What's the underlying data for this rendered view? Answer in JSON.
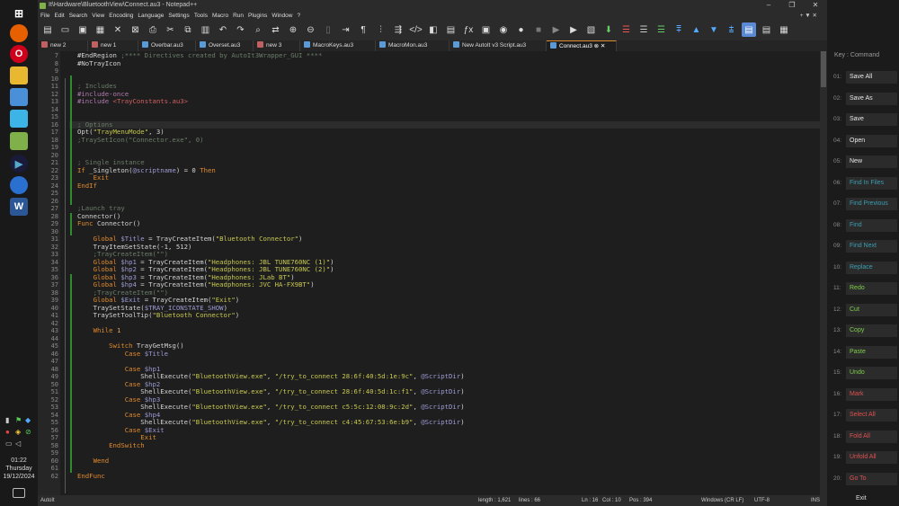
{
  "window": {
    "title": "It\\Hardware\\BluetoothView\\Connect.au3 - Notepad++",
    "minimize": "–",
    "restore": "❐",
    "close": "✕"
  },
  "menu": [
    "File",
    "Edit",
    "Search",
    "View",
    "Encoding",
    "Language",
    "Settings",
    "Tools",
    "Macro",
    "Run",
    "Plugins",
    "Window",
    "?"
  ],
  "menu_right": "+ ▼ ✕",
  "tabs": [
    {
      "label": "new 2",
      "color": "#c06060"
    },
    {
      "label": "new 1",
      "color": "#c06060"
    },
    {
      "label": "Overbar.au3",
      "color": "#5a9ad6"
    },
    {
      "label": "Overset.au3",
      "color": "#5a9ad6"
    },
    {
      "label": "new 3",
      "color": "#c06060"
    },
    {
      "label": "MacroKeys.au3",
      "color": "#5a9ad6"
    },
    {
      "label": "MacroMon.au3",
      "color": "#5a9ad6"
    },
    {
      "label": "New AutoIt v3 Script.au3",
      "color": "#5a9ad6"
    },
    {
      "label": "Connect.au3",
      "color": "#5a9ad6"
    }
  ],
  "lines": [
    {
      "n": "7",
      "t": [
        [
          "o",
          "#EndRegion "
        ],
        [
          "c",
          ";**** Directives created by AutoIt3Wrapper_GUI ****"
        ]
      ]
    },
    {
      "n": "8",
      "t": [
        [
          "o",
          "#NoTrayIcon"
        ]
      ]
    },
    {
      "n": "9",
      "t": []
    },
    {
      "n": "10",
      "t": []
    },
    {
      "n": "11",
      "t": [
        [
          "c",
          "; Includes"
        ]
      ]
    },
    {
      "n": "12",
      "t": [
        [
          "m",
          "#include-once"
        ]
      ]
    },
    {
      "n": "13",
      "t": [
        [
          "m",
          "#include "
        ],
        [
          "i",
          "<TrayConstants.au3>"
        ]
      ]
    },
    {
      "n": "14",
      "t": []
    },
    {
      "n": "15",
      "t": []
    },
    {
      "n": "16",
      "t": [
        [
          "c",
          "; Options"
        ]
      ]
    },
    {
      "n": "17",
      "t": [
        [
          "f",
          "Opt("
        ],
        [
          "s",
          "\"TrayMenuMode\""
        ],
        [
          "o",
          ", 3)"
        ]
      ]
    },
    {
      "n": "18",
      "t": [
        [
          "c",
          ";TraySetIcon(\"Connector.exe\", 0)"
        ]
      ]
    },
    {
      "n": "19",
      "t": []
    },
    {
      "n": "20",
      "t": []
    },
    {
      "n": "21",
      "t": [
        [
          "c",
          "; Single instance"
        ]
      ]
    },
    {
      "n": "22",
      "t": [
        [
          "k",
          "If "
        ],
        [
          "o",
          "_Singleton("
        ],
        [
          "v",
          "@scriptname"
        ],
        [
          "o",
          ") = 0 "
        ],
        [
          "k",
          "Then"
        ]
      ]
    },
    {
      "n": "23",
      "t": [
        [
          "k",
          "    Exit"
        ]
      ]
    },
    {
      "n": "24",
      "t": [
        [
          "k",
          "EndIf"
        ]
      ]
    },
    {
      "n": "25",
      "t": []
    },
    {
      "n": "26",
      "t": []
    },
    {
      "n": "27",
      "t": [
        [
          "c",
          ";Launch tray"
        ]
      ]
    },
    {
      "n": "28",
      "t": [
        [
          "o",
          "Connector()"
        ]
      ]
    },
    {
      "n": "29",
      "t": [
        [
          "k",
          "Func "
        ],
        [
          "o",
          "Connector()"
        ]
      ]
    },
    {
      "n": "30",
      "t": []
    },
    {
      "n": "31",
      "t": [
        [
          "k",
          "    Global "
        ],
        [
          "v",
          "$Title"
        ],
        [
          "o",
          " = TrayCreateItem("
        ],
        [
          "s",
          "\"Bluetooth Connector\""
        ],
        [
          "o",
          ")"
        ]
      ]
    },
    {
      "n": "32",
      "t": [
        [
          "o",
          "    TrayItemSetState(-1, 512)"
        ]
      ]
    },
    {
      "n": "33",
      "t": [
        [
          "c",
          "    ;TrayCreateItem(\"\")"
        ]
      ]
    },
    {
      "n": "34",
      "t": [
        [
          "k",
          "    Global "
        ],
        [
          "v",
          "$hp1"
        ],
        [
          "o",
          " = TrayCreateItem("
        ],
        [
          "s",
          "\"Headphones: JBL TUNE760NC (1)\""
        ],
        [
          "o",
          ")"
        ]
      ]
    },
    {
      "n": "35",
      "t": [
        [
          "k",
          "    Global "
        ],
        [
          "v",
          "$hp2"
        ],
        [
          "o",
          " = TrayCreateItem("
        ],
        [
          "s",
          "\"Headphones: JBL TUNE760NC (2)\""
        ],
        [
          "o",
          ")"
        ]
      ]
    },
    {
      "n": "36",
      "t": [
        [
          "k",
          "    Global "
        ],
        [
          "v",
          "$hp3"
        ],
        [
          "o",
          " = TrayCreateItem("
        ],
        [
          "s",
          "\"Headphones: JLab BT\""
        ],
        [
          "o",
          ")"
        ]
      ]
    },
    {
      "n": "37",
      "t": [
        [
          "k",
          "    Global "
        ],
        [
          "v",
          "$hp4"
        ],
        [
          "o",
          " = TrayCreateItem("
        ],
        [
          "s",
          "\"Headphones: JVC HA-FX9BT\""
        ],
        [
          "o",
          ")"
        ]
      ]
    },
    {
      "n": "38",
      "t": [
        [
          "c",
          "    ;TrayCreateItem(\"\")"
        ]
      ]
    },
    {
      "n": "39",
      "t": [
        [
          "k",
          "    Global "
        ],
        [
          "v",
          "$Exit"
        ],
        [
          "o",
          " = TrayCreateItem("
        ],
        [
          "s",
          "\"Exit\""
        ],
        [
          "o",
          ")"
        ]
      ]
    },
    {
      "n": "40",
      "t": [
        [
          "o",
          "    TraySetState("
        ],
        [
          "v",
          "$TRAY_ICONSTATE_SHOW"
        ],
        [
          "o",
          ")"
        ]
      ]
    },
    {
      "n": "41",
      "t": [
        [
          "o",
          "    TraySetToolTip("
        ],
        [
          "s",
          "\"Bluetooth Connector\""
        ],
        [
          "o",
          ")"
        ]
      ]
    },
    {
      "n": "42",
      "t": []
    },
    {
      "n": "43",
      "t": [
        [
          "k",
          "    While "
        ],
        [
          "n",
          "1"
        ]
      ]
    },
    {
      "n": "44",
      "t": []
    },
    {
      "n": "45",
      "t": [
        [
          "k",
          "        Switch "
        ],
        [
          "o",
          "TrayGetMsg()"
        ]
      ]
    },
    {
      "n": "46",
      "t": [
        [
          "k",
          "            Case "
        ],
        [
          "v",
          "$Title"
        ]
      ]
    },
    {
      "n": "47",
      "t": []
    },
    {
      "n": "48",
      "t": [
        [
          "k",
          "            Case "
        ],
        [
          "v",
          "$hp1"
        ]
      ]
    },
    {
      "n": "49",
      "t": [
        [
          "o",
          "                ShellExecute("
        ],
        [
          "s",
          "\"BluetoothView.exe\""
        ],
        [
          "o",
          ", "
        ],
        [
          "s",
          "\"/try_to_connect 28:6f:40:5d:1e:9c\""
        ],
        [
          "o",
          ", "
        ],
        [
          "v",
          "@ScriptDir"
        ],
        [
          "o",
          ")"
        ]
      ]
    },
    {
      "n": "50",
      "t": [
        [
          "k",
          "            Case "
        ],
        [
          "v",
          "$hp2"
        ]
      ]
    },
    {
      "n": "51",
      "t": [
        [
          "o",
          "                ShellExecute("
        ],
        [
          "s",
          "\"BluetoothView.exe\""
        ],
        [
          "o",
          ", "
        ],
        [
          "s",
          "\"/try_to_connect 28:6f:40:5d:1c:f1\""
        ],
        [
          "o",
          ", "
        ],
        [
          "v",
          "@ScriptDir"
        ],
        [
          "o",
          ")"
        ]
      ]
    },
    {
      "n": "52",
      "t": [
        [
          "k",
          "            Case "
        ],
        [
          "v",
          "$hp3"
        ]
      ]
    },
    {
      "n": "53",
      "t": [
        [
          "o",
          "                ShellExecute("
        ],
        [
          "s",
          "\"BluetoothView.exe\""
        ],
        [
          "o",
          ", "
        ],
        [
          "s",
          "\"/try_to_connect c5:5c:12:08:9c:2d\""
        ],
        [
          "o",
          ", "
        ],
        [
          "v",
          "@ScriptDir"
        ],
        [
          "o",
          ")"
        ]
      ]
    },
    {
      "n": "54",
      "t": [
        [
          "k",
          "            Case "
        ],
        [
          "v",
          "$hp4"
        ]
      ]
    },
    {
      "n": "55",
      "t": [
        [
          "o",
          "                ShellExecute("
        ],
        [
          "s",
          "\"BluetoothView.exe\""
        ],
        [
          "o",
          ", "
        ],
        [
          "s",
          "\"/try_to_connect c4:45:67:53:6e:b9\""
        ],
        [
          "o",
          ", "
        ],
        [
          "v",
          "@ScriptDir"
        ],
        [
          "o",
          ")"
        ]
      ]
    },
    {
      "n": "56",
      "t": [
        [
          "k",
          "            Case "
        ],
        [
          "v",
          "$Exit"
        ]
      ]
    },
    {
      "n": "57",
      "t": [
        [
          "k",
          "                Exit"
        ]
      ]
    },
    {
      "n": "58",
      "t": [
        [
          "k",
          "        EndSwitch"
        ]
      ]
    },
    {
      "n": "59",
      "t": []
    },
    {
      "n": "60",
      "t": [
        [
          "k",
          "    Wend"
        ]
      ]
    },
    {
      "n": "61",
      "t": []
    },
    {
      "n": "62",
      "t": [
        [
          "k",
          "EndFunc"
        ]
      ]
    }
  ],
  "status": {
    "lang": "AutoIt",
    "length": "length : 1,621",
    "lines": "lines : 66",
    "ln": "Ln : 16",
    "col": "Col : 10",
    "pos": "Pos : 394",
    "eol": "Windows (CR LF)",
    "enc": "UTF-8",
    "ins": "INS"
  },
  "clock": {
    "time": "01:22",
    "day": "Thursday",
    "date": "19/12/2024"
  },
  "panel": {
    "header": "Key : Command",
    "items": [
      {
        "num": "01:",
        "label": "Save All",
        "color": "#e8e8e8"
      },
      {
        "num": "02:",
        "label": "Save As",
        "color": "#e8e8e8"
      },
      {
        "num": "03:",
        "label": "Save",
        "color": "#e8e8e8"
      },
      {
        "num": "04:",
        "label": "Open",
        "color": "#e8e8e8"
      },
      {
        "num": "05:",
        "label": "New",
        "color": "#e8e8e8"
      },
      {
        "num": "06:",
        "label": "Find In Files",
        "color": "#3a9fb0"
      },
      {
        "num": "07:",
        "label": "Find Previous",
        "color": "#3a9fb0"
      },
      {
        "num": "08:",
        "label": "Find",
        "color": "#3a9fb0"
      },
      {
        "num": "09:",
        "label": "Find Next",
        "color": "#3a9fb0"
      },
      {
        "num": "10:",
        "label": "Replace",
        "color": "#3a9fb0"
      },
      {
        "num": "11:",
        "label": "Redo",
        "color": "#7fcf4a"
      },
      {
        "num": "12:",
        "label": "Cut",
        "color": "#7fcf4a"
      },
      {
        "num": "13:",
        "label": "Copy",
        "color": "#7fcf4a"
      },
      {
        "num": "14:",
        "label": "Paste",
        "color": "#7fcf4a"
      },
      {
        "num": "15:",
        "label": "Undo",
        "color": "#7fcf4a"
      },
      {
        "num": "16:",
        "label": "Mark",
        "color": "#e05050"
      },
      {
        "num": "17:",
        "label": "Select All",
        "color": "#e05050"
      },
      {
        "num": "18:",
        "label": "Fold All",
        "color": "#e05050"
      },
      {
        "num": "19:",
        "label": "Unfold All",
        "color": "#e05050"
      },
      {
        "num": "20:",
        "label": "Go To",
        "color": "#e05050"
      }
    ],
    "exit": "Exit"
  }
}
